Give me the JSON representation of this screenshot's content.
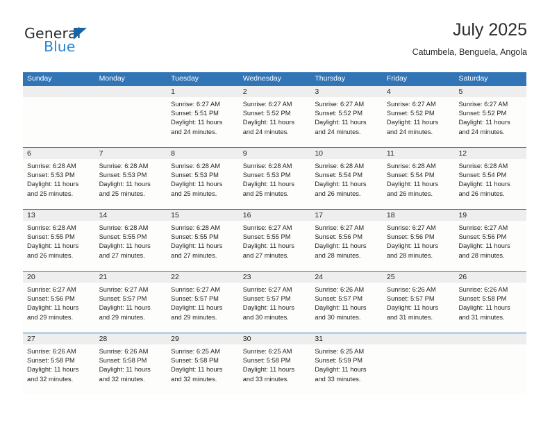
{
  "brand": {
    "name_part1": "General",
    "name_part2": "Blue",
    "logo_icon": "triangle-logo-icon",
    "color_primary": "#2a86d0",
    "color_triangle": "#1565a8"
  },
  "header": {
    "title": "July 2025",
    "subtitle": "Catumbela, Benguela, Angola"
  },
  "calendar": {
    "header_bg": "#3275b6",
    "daynum_bg": "#eeeeee",
    "weekdays": [
      "Sunday",
      "Monday",
      "Tuesday",
      "Wednesday",
      "Thursday",
      "Friday",
      "Saturday"
    ],
    "weeks": [
      {
        "cells": [
          {
            "day": "",
            "sunrise": "",
            "sunset": "",
            "daylight_line1": "",
            "daylight_line2": "",
            "empty": true
          },
          {
            "day": "",
            "sunrise": "",
            "sunset": "",
            "daylight_line1": "",
            "daylight_line2": "",
            "empty": true
          },
          {
            "day": "1",
            "sunrise": "Sunrise: 6:27 AM",
            "sunset": "Sunset: 5:51 PM",
            "daylight_line1": "Daylight: 11 hours",
            "daylight_line2": "and 24 minutes.",
            "empty": false
          },
          {
            "day": "2",
            "sunrise": "Sunrise: 6:27 AM",
            "sunset": "Sunset: 5:52 PM",
            "daylight_line1": "Daylight: 11 hours",
            "daylight_line2": "and 24 minutes.",
            "empty": false
          },
          {
            "day": "3",
            "sunrise": "Sunrise: 6:27 AM",
            "sunset": "Sunset: 5:52 PM",
            "daylight_line1": "Daylight: 11 hours",
            "daylight_line2": "and 24 minutes.",
            "empty": false
          },
          {
            "day": "4",
            "sunrise": "Sunrise: 6:27 AM",
            "sunset": "Sunset: 5:52 PM",
            "daylight_line1": "Daylight: 11 hours",
            "daylight_line2": "and 24 minutes.",
            "empty": false
          },
          {
            "day": "5",
            "sunrise": "Sunrise: 6:27 AM",
            "sunset": "Sunset: 5:52 PM",
            "daylight_line1": "Daylight: 11 hours",
            "daylight_line2": "and 24 minutes.",
            "empty": false
          }
        ]
      },
      {
        "cells": [
          {
            "day": "6",
            "sunrise": "Sunrise: 6:28 AM",
            "sunset": "Sunset: 5:53 PM",
            "daylight_line1": "Daylight: 11 hours",
            "daylight_line2": "and 25 minutes.",
            "empty": false
          },
          {
            "day": "7",
            "sunrise": "Sunrise: 6:28 AM",
            "sunset": "Sunset: 5:53 PM",
            "daylight_line1": "Daylight: 11 hours",
            "daylight_line2": "and 25 minutes.",
            "empty": false
          },
          {
            "day": "8",
            "sunrise": "Sunrise: 6:28 AM",
            "sunset": "Sunset: 5:53 PM",
            "daylight_line1": "Daylight: 11 hours",
            "daylight_line2": "and 25 minutes.",
            "empty": false
          },
          {
            "day": "9",
            "sunrise": "Sunrise: 6:28 AM",
            "sunset": "Sunset: 5:53 PM",
            "daylight_line1": "Daylight: 11 hours",
            "daylight_line2": "and 25 minutes.",
            "empty": false
          },
          {
            "day": "10",
            "sunrise": "Sunrise: 6:28 AM",
            "sunset": "Sunset: 5:54 PM",
            "daylight_line1": "Daylight: 11 hours",
            "daylight_line2": "and 26 minutes.",
            "empty": false
          },
          {
            "day": "11",
            "sunrise": "Sunrise: 6:28 AM",
            "sunset": "Sunset: 5:54 PM",
            "daylight_line1": "Daylight: 11 hours",
            "daylight_line2": "and 26 minutes.",
            "empty": false
          },
          {
            "day": "12",
            "sunrise": "Sunrise: 6:28 AM",
            "sunset": "Sunset: 5:54 PM",
            "daylight_line1": "Daylight: 11 hours",
            "daylight_line2": "and 26 minutes.",
            "empty": false
          }
        ]
      },
      {
        "cells": [
          {
            "day": "13",
            "sunrise": "Sunrise: 6:28 AM",
            "sunset": "Sunset: 5:55 PM",
            "daylight_line1": "Daylight: 11 hours",
            "daylight_line2": "and 26 minutes.",
            "empty": false
          },
          {
            "day": "14",
            "sunrise": "Sunrise: 6:28 AM",
            "sunset": "Sunset: 5:55 PM",
            "daylight_line1": "Daylight: 11 hours",
            "daylight_line2": "and 27 minutes.",
            "empty": false
          },
          {
            "day": "15",
            "sunrise": "Sunrise: 6:28 AM",
            "sunset": "Sunset: 5:55 PM",
            "daylight_line1": "Daylight: 11 hours",
            "daylight_line2": "and 27 minutes.",
            "empty": false
          },
          {
            "day": "16",
            "sunrise": "Sunrise: 6:27 AM",
            "sunset": "Sunset: 5:55 PM",
            "daylight_line1": "Daylight: 11 hours",
            "daylight_line2": "and 27 minutes.",
            "empty": false
          },
          {
            "day": "17",
            "sunrise": "Sunrise: 6:27 AM",
            "sunset": "Sunset: 5:56 PM",
            "daylight_line1": "Daylight: 11 hours",
            "daylight_line2": "and 28 minutes.",
            "empty": false
          },
          {
            "day": "18",
            "sunrise": "Sunrise: 6:27 AM",
            "sunset": "Sunset: 5:56 PM",
            "daylight_line1": "Daylight: 11 hours",
            "daylight_line2": "and 28 minutes.",
            "empty": false
          },
          {
            "day": "19",
            "sunrise": "Sunrise: 6:27 AM",
            "sunset": "Sunset: 5:56 PM",
            "daylight_line1": "Daylight: 11 hours",
            "daylight_line2": "and 28 minutes.",
            "empty": false
          }
        ]
      },
      {
        "cells": [
          {
            "day": "20",
            "sunrise": "Sunrise: 6:27 AM",
            "sunset": "Sunset: 5:56 PM",
            "daylight_line1": "Daylight: 11 hours",
            "daylight_line2": "and 29 minutes.",
            "empty": false
          },
          {
            "day": "21",
            "sunrise": "Sunrise: 6:27 AM",
            "sunset": "Sunset: 5:57 PM",
            "daylight_line1": "Daylight: 11 hours",
            "daylight_line2": "and 29 minutes.",
            "empty": false
          },
          {
            "day": "22",
            "sunrise": "Sunrise: 6:27 AM",
            "sunset": "Sunset: 5:57 PM",
            "daylight_line1": "Daylight: 11 hours",
            "daylight_line2": "and 29 minutes.",
            "empty": false
          },
          {
            "day": "23",
            "sunrise": "Sunrise: 6:27 AM",
            "sunset": "Sunset: 5:57 PM",
            "daylight_line1": "Daylight: 11 hours",
            "daylight_line2": "and 30 minutes.",
            "empty": false
          },
          {
            "day": "24",
            "sunrise": "Sunrise: 6:26 AM",
            "sunset": "Sunset: 5:57 PM",
            "daylight_line1": "Daylight: 11 hours",
            "daylight_line2": "and 30 minutes.",
            "empty": false
          },
          {
            "day": "25",
            "sunrise": "Sunrise: 6:26 AM",
            "sunset": "Sunset: 5:57 PM",
            "daylight_line1": "Daylight: 11 hours",
            "daylight_line2": "and 31 minutes.",
            "empty": false
          },
          {
            "day": "26",
            "sunrise": "Sunrise: 6:26 AM",
            "sunset": "Sunset: 5:58 PM",
            "daylight_line1": "Daylight: 11 hours",
            "daylight_line2": "and 31 minutes.",
            "empty": false
          }
        ]
      },
      {
        "cells": [
          {
            "day": "27",
            "sunrise": "Sunrise: 6:26 AM",
            "sunset": "Sunset: 5:58 PM",
            "daylight_line1": "Daylight: 11 hours",
            "daylight_line2": "and 32 minutes.",
            "empty": false
          },
          {
            "day": "28",
            "sunrise": "Sunrise: 6:26 AM",
            "sunset": "Sunset: 5:58 PM",
            "daylight_line1": "Daylight: 11 hours",
            "daylight_line2": "and 32 minutes.",
            "empty": false
          },
          {
            "day": "29",
            "sunrise": "Sunrise: 6:25 AM",
            "sunset": "Sunset: 5:58 PM",
            "daylight_line1": "Daylight: 11 hours",
            "daylight_line2": "and 32 minutes.",
            "empty": false
          },
          {
            "day": "30",
            "sunrise": "Sunrise: 6:25 AM",
            "sunset": "Sunset: 5:58 PM",
            "daylight_line1": "Daylight: 11 hours",
            "daylight_line2": "and 33 minutes.",
            "empty": false
          },
          {
            "day": "31",
            "sunrise": "Sunrise: 6:25 AM",
            "sunset": "Sunset: 5:59 PM",
            "daylight_line1": "Daylight: 11 hours",
            "daylight_line2": "and 33 minutes.",
            "empty": false
          },
          {
            "day": "",
            "sunrise": "",
            "sunset": "",
            "daylight_line1": "",
            "daylight_line2": "",
            "empty": true
          },
          {
            "day": "",
            "sunrise": "",
            "sunset": "",
            "daylight_line1": "",
            "daylight_line2": "",
            "empty": true
          }
        ]
      }
    ]
  }
}
